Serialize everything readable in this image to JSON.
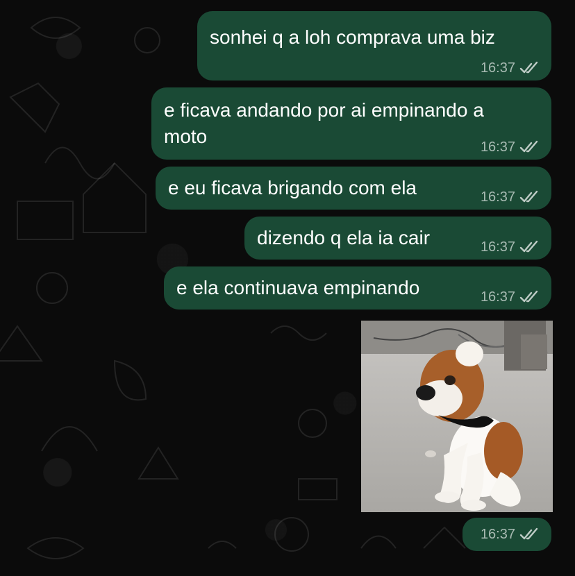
{
  "messages": [
    {
      "text": "sonhei q a loh comprava uma biz",
      "time": "16:37",
      "status": "read"
    },
    {
      "text": "e ficava andando por ai empinando a\nmoto",
      "time": "16:37",
      "status": "read"
    },
    {
      "text": "e eu ficava brigando com ela",
      "time": "16:37",
      "status": "read"
    },
    {
      "text": "dizendo q ela ia cair",
      "time": "16:37",
      "status": "read"
    },
    {
      "text": "e ela continuava empinando",
      "time": "16:37",
      "status": "read"
    }
  ],
  "media_message": {
    "time": "16:37",
    "status": "read"
  },
  "colors": {
    "background": "#0b0b0b",
    "bubble": "#1a4a35",
    "text": "#ffffff",
    "timestamp": "rgba(255,255,255,0.62)"
  },
  "icons": {
    "read_receipt": "double-check-icon"
  }
}
